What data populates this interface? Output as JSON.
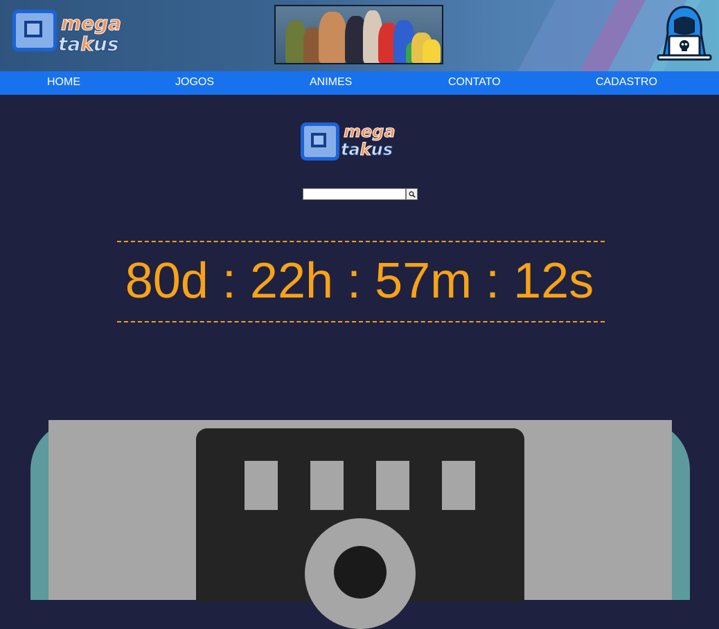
{
  "header": {
    "logo": {
      "word_top": "mega",
      "word_bottom_a": "ta",
      "word_bottom_k": "k",
      "word_bottom_b": "us"
    },
    "banner_icon": "anime-game-characters-banner",
    "avatar_icon": "hooded-hacker-laptop-icon"
  },
  "nav": {
    "items": [
      {
        "label": "HOME"
      },
      {
        "label": "JOGOS"
      },
      {
        "label": "ANIMES"
      },
      {
        "label": "CONTATO"
      },
      {
        "label": "CADASTRO"
      }
    ]
  },
  "main": {
    "logo": {
      "word_top": "mega",
      "word_bottom_a": "ta",
      "word_bottom_k": "k",
      "word_bottom_b": "us"
    },
    "search": {
      "placeholder": "",
      "value": "",
      "button_icon": "magnifier-icon"
    },
    "countdown": {
      "days": "80d",
      "hours": "22h",
      "minutes": "57m",
      "seconds": "12s",
      "separator": " : "
    },
    "illustration_icon": "server-rack-icon"
  },
  "colors": {
    "page_bg": "#1f2140",
    "nav_bg": "#1872ee",
    "countdown": "#f7a318",
    "illustration_teal": "#5d9a9d",
    "illustration_gray": "#a6a6a6",
    "illustration_dark": "#242424"
  }
}
